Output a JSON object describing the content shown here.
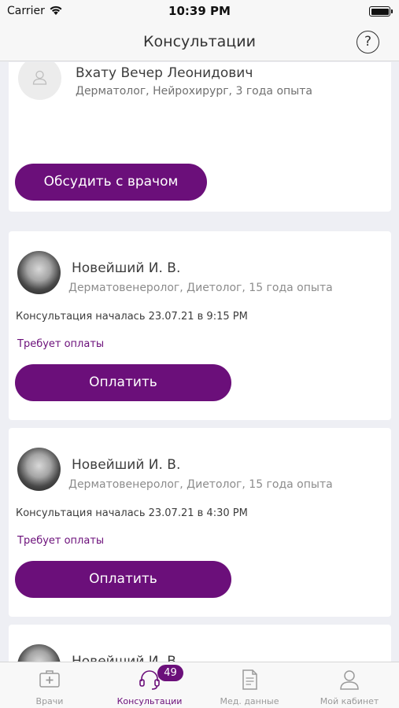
{
  "status_bar": {
    "carrier": "Carrier",
    "time": "10:39 PM"
  },
  "nav": {
    "title": "Консультации",
    "help_label": "?"
  },
  "cards": [
    {
      "doctor_name": "Вхату  Вечер Леонидович",
      "specialty": "Дерматолог, Нейрохирург, 3 года опыта",
      "button_label": "Обсудить с врачом"
    },
    {
      "doctor_name": "Новейший И. В.",
      "specialty": "Дерматовенеролог, Диетолог, 15 года опыта",
      "consultation_start": "Консультация началась 23.07.21 в 9:15 PM",
      "payment_status": "Требует оплаты",
      "button_label": "Оплатить"
    },
    {
      "doctor_name": "Новейший И. В.",
      "specialty": "Дерматовенеролог, Диетолог, 15 года опыта",
      "consultation_start": "Консультация началась 23.07.21 в 4:30 PM",
      "payment_status": "Требует оплаты",
      "button_label": "Оплатить"
    },
    {
      "doctor_name": "Новейший И. В."
    }
  ],
  "tab_bar": {
    "tabs": [
      {
        "label": "Врачи",
        "icon": "medical-kit-icon"
      },
      {
        "label": "Консультации",
        "icon": "headset-icon",
        "badge": "49",
        "active": true
      },
      {
        "label": "Мед. данные",
        "icon": "document-icon"
      },
      {
        "label": "Мой кабинет",
        "icon": "user-icon"
      }
    ]
  },
  "colors": {
    "accent": "#6b0f7a",
    "background": "#eeeff4",
    "inactive_tab": "#9a9a9a"
  }
}
